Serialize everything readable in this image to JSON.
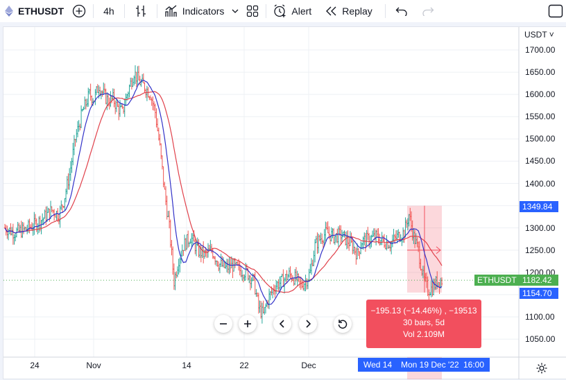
{
  "toolbar": {
    "symbol": "ETHUSDT",
    "interval": "4h",
    "indicators_label": "Indicators",
    "alert_label": "Alert",
    "replay_label": "Replay"
  },
  "axis": {
    "currency": "USDT ˅",
    "price_labels": [
      "1700.00",
      "1650.00",
      "1600.00",
      "1550.00",
      "1500.00",
      "1450.00",
      "1400.00",
      "1350.00",
      "1300.00",
      "1250.00",
      "1200.00",
      "1150.00",
      "1100.00",
      "1050.00"
    ],
    "time_labels": [
      "24",
      "Nov",
      "14",
      "22",
      "Dec"
    ]
  },
  "tags": {
    "price_high": "1349.84",
    "symbol_tag": "ETHUSDT",
    "last_price": "1182.42",
    "price_low": "1154.70",
    "time_start": "Wed 14",
    "time_end": "Mon 19 Dec '22",
    "time_hour": "16:00"
  },
  "measure": {
    "line1": "−195.13 (−14.46%) , −19513",
    "line2": "30 bars, 5d",
    "line3": "Vol 2.109M"
  },
  "colors": {
    "up": "#26a69a",
    "down": "#ef5350",
    "ma_fast": "#3131c8",
    "ma_slow": "#e0404a",
    "accent": "#2962ff",
    "measure_bg": "#f24f5e",
    "last_price_bg": "#4caf50"
  },
  "chart_data": {
    "type": "candlestick",
    "symbol": "ETHUSDT",
    "interval": "4h",
    "ylim": [
      1020,
      1730
    ],
    "x_ticks": [
      "24",
      "Nov",
      "14",
      "22",
      "Dec"
    ],
    "close_path": [
      [
        0,
        1300
      ],
      [
        8,
        1290
      ],
      [
        16,
        1295
      ],
      [
        24,
        1305
      ],
      [
        32,
        1320
      ],
      [
        40,
        1340
      ],
      [
        46,
        1330
      ],
      [
        50,
        1360
      ],
      [
        55,
        1420
      ],
      [
        60,
        1500
      ],
      [
        66,
        1560
      ],
      [
        72,
        1600
      ],
      [
        76,
        1590
      ],
      [
        80,
        1620
      ],
      [
        84,
        1600
      ],
      [
        88,
        1585
      ],
      [
        92,
        1590
      ],
      [
        96,
        1570
      ],
      [
        100,
        1560
      ],
      [
        104,
        1600
      ],
      [
        110,
        1650
      ],
      [
        114,
        1630
      ],
      [
        118,
        1620
      ],
      [
        124,
        1600
      ],
      [
        128,
        1560
      ],
      [
        132,
        1480
      ],
      [
        136,
        1380
      ],
      [
        140,
        1300
      ],
      [
        144,
        1180
      ],
      [
        148,
        1230
      ],
      [
        152,
        1260
      ],
      [
        158,
        1280
      ],
      [
        164,
        1250
      ],
      [
        170,
        1240
      ],
      [
        176,
        1250
      ],
      [
        182,
        1220
      ],
      [
        188,
        1210
      ],
      [
        194,
        1215
      ],
      [
        200,
        1205
      ],
      [
        206,
        1200
      ],
      [
        212,
        1180
      ],
      [
        216,
        1120
      ],
      [
        220,
        1105
      ],
      [
        224,
        1140
      ],
      [
        230,
        1170
      ],
      [
        236,
        1180
      ],
      [
        242,
        1195
      ],
      [
        248,
        1185
      ],
      [
        252,
        1170
      ],
      [
        256,
        1180
      ],
      [
        260,
        1200
      ],
      [
        264,
        1260
      ],
      [
        268,
        1275
      ],
      [
        274,
        1290
      ],
      [
        280,
        1280
      ],
      [
        286,
        1285
      ],
      [
        292,
        1270
      ],
      [
        296,
        1260
      ],
      [
        300,
        1240
      ],
      [
        304,
        1270
      ],
      [
        310,
        1275
      ],
      [
        316,
        1280
      ],
      [
        322,
        1270
      ],
      [
        328,
        1265
      ],
      [
        334,
        1280
      ],
      [
        340,
        1290
      ],
      [
        344,
        1330
      ],
      [
        348,
        1280
      ],
      [
        352,
        1250
      ],
      [
        356,
        1190
      ],
      [
        360,
        1160
      ],
      [
        364,
        1165
      ],
      [
        368,
        1180
      ],
      [
        372,
        1182
      ]
    ],
    "last_close": 1182.42,
    "ma_fast_name": "",
    "ma_slow_name": "",
    "measurement": {
      "from_time": "Wed 14",
      "to_time": "Mon 19 Dec '22 16:00",
      "from_price": 1349.84,
      "to_price": 1154.7,
      "change": -195.13,
      "change_pct": -14.46,
      "bars": 30,
      "days": 5,
      "volume": "2.109M"
    },
    "grid": true,
    "price_axis": "right"
  }
}
